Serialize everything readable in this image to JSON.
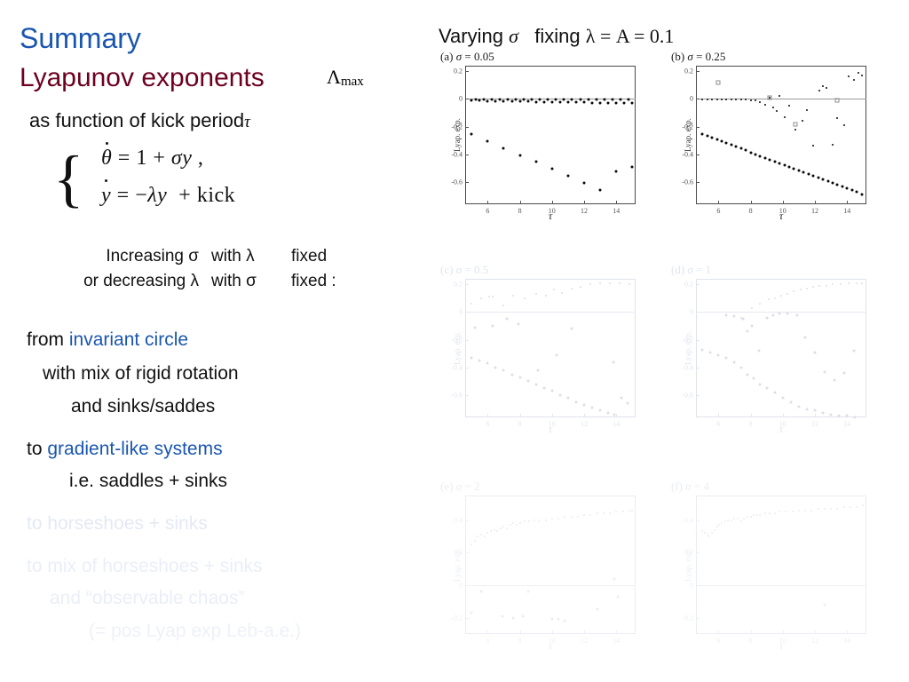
{
  "left": {
    "title_summary": "Summary",
    "title_lyapunov": "Lyapunov exponents",
    "lambda_max": "Λ",
    "lambda_max_sub": "max",
    "subtitle_prefix": "as function of kick period",
    "subtitle_tau": "τ",
    "equations": {
      "line1": "θ = 1 + σy ,",
      "line2": "y = −λy  + kick",
      "brace": "{"
    },
    "incdec": [
      {
        "c1": "Increasing σ",
        "c2": "with λ",
        "c3": "fixed"
      },
      {
        "c1": "or decreasing λ",
        "c2": "with σ",
        "c3": "fixed :"
      }
    ],
    "narrative": [
      {
        "plain": "from ",
        "accent": "invariant circle",
        "tone": "normal"
      },
      {
        "plain": "with mix of rigid rotation",
        "accent": "",
        "tone": "normal"
      },
      {
        "plain": "and  sinks/saddes",
        "accent": "",
        "tone": "normal"
      },
      {
        "plain": "to ",
        "accent": "gradient-like systems",
        "tone": "normal"
      },
      {
        "plain": "i.e. saddles + sinks",
        "accent": "",
        "tone": "normal"
      },
      {
        "plain": "to ",
        "accent": "horseshoes + sinks",
        "tone": "fade1"
      },
      {
        "plain": "to ",
        "accent": "mix of horseshoes + sinks",
        "tone": "fade2"
      },
      {
        "plain": "and  “observable chaos”",
        "accent": "",
        "tone": "fade2"
      },
      {
        "plain": "(= pos Lyap exp Leb-a.e.)",
        "accent": "",
        "tone": "fade3"
      }
    ],
    "colors": {
      "blue": "#1a56b0",
      "darkred": "#6d0020",
      "black": "#111111"
    }
  },
  "right": {
    "header": "Varying σ   fixing λ = A = 0.1",
    "header_parts": {
      "varying": "Varying",
      "sigma": "σ",
      "fixing": "fixing",
      "lambda_eq": "λ = A = 0.1"
    }
  },
  "chart_data": [
    {
      "id": "a",
      "type": "scatter",
      "title": "(a) σ = 0.05",
      "panel_letter": "(a)",
      "sigma": "0.05",
      "xlabel": "τ",
      "ylabel": "Lyap. exp.",
      "xlim": [
        4.6,
        15.2
      ],
      "ylim": [
        -0.76,
        0.24
      ],
      "xticks": [
        6,
        8,
        10,
        12,
        14
      ],
      "yticks": [
        0.2,
        0,
        -0.2,
        -0.4,
        -0.6
      ],
      "ytick_labels": [
        "0.2",
        "0",
        "-0.2",
        "-0.4",
        "-0.6"
      ],
      "grid": false,
      "opacity": 1,
      "series": [
        {
          "name": "upper-exponent",
          "x": [
            5,
            5.25,
            5.5,
            5.75,
            6,
            6.25,
            6.5,
            6.75,
            7,
            7.25,
            7.5,
            7.75,
            8,
            8.25,
            8.5,
            8.75,
            9,
            9.25,
            9.5,
            9.75,
            10,
            10.25,
            10.5,
            10.75,
            11,
            11.25,
            11.5,
            11.75,
            12,
            12.25,
            12.5,
            12.75,
            13,
            13.25,
            13.5,
            13.75,
            14,
            14.25,
            14.5,
            14.75,
            15
          ],
          "y": [
            -0.01,
            -0.005,
            -0.012,
            -0.004,
            -0.014,
            -0.005,
            -0.015,
            -0.004,
            -0.016,
            -0.005,
            -0.017,
            -0.004,
            -0.018,
            -0.005,
            -0.019,
            -0.004,
            -0.02,
            -0.005,
            -0.021,
            -0.004,
            -0.022,
            -0.005,
            -0.023,
            -0.004,
            -0.024,
            -0.005,
            -0.025,
            -0.004,
            -0.026,
            -0.005,
            -0.027,
            -0.004,
            -0.028,
            -0.005,
            -0.029,
            -0.004,
            -0.03,
            -0.005,
            -0.031,
            -0.004,
            -0.032
          ]
        },
        {
          "name": "lower-exponent",
          "x": [
            5,
            6,
            7,
            8,
            9,
            10,
            11,
            12,
            13,
            14,
            15
          ],
          "y": [
            -0.255,
            -0.305,
            -0.355,
            -0.405,
            -0.455,
            -0.505,
            -0.555,
            -0.605,
            -0.655,
            -0.525,
            -0.49
          ]
        }
      ]
    },
    {
      "id": "b",
      "type": "scatter",
      "title": "(b) σ = 0.25",
      "panel_letter": "(b)",
      "sigma": "0.25",
      "xlabel": "τ",
      "ylabel": "Lyap. exp.",
      "xlim": [
        4.6,
        15.2
      ],
      "ylim": [
        -0.76,
        0.24
      ],
      "xticks": [
        6,
        8,
        10,
        12,
        14
      ],
      "yticks": [
        0.2,
        0,
        -0.2,
        -0.4,
        -0.6
      ],
      "ytick_labels": [
        "0.2",
        "0",
        "-0.2",
        "-0.4",
        "-0.6"
      ],
      "grid": false,
      "opacity": 1,
      "series": [
        {
          "name": "upper-exponent",
          "x": [
            5,
            5.3,
            5.6,
            5.9,
            6.2,
            6.5,
            6.8,
            7.1,
            7.4,
            7.7,
            8,
            8.3,
            8.6,
            8.9,
            9.2,
            9.4,
            9.6,
            9.8,
            10.1,
            10.4,
            10.8,
            11.2,
            11.5,
            11.9,
            12.3,
            12.5,
            12.7,
            13.1,
            13.4,
            13.8,
            14.1,
            14.4,
            14.7,
            14.9
          ],
          "y": [
            -0.005,
            -0.006,
            -0.004,
            -0.005,
            -0.006,
            -0.004,
            -0.005,
            -0.006,
            -0.004,
            -0.005,
            -0.008,
            -0.012,
            -0.02,
            -0.04,
            0.01,
            -0.06,
            -0.09,
            0.02,
            -0.13,
            -0.05,
            -0.22,
            -0.16,
            -0.08,
            -0.34,
            0.06,
            0.09,
            0.08,
            -0.33,
            -0.14,
            -0.19,
            0.16,
            0.14,
            0.19,
            0.17
          ]
        },
        {
          "name": "lower-exponent",
          "x": [
            5,
            5.3,
            5.6,
            5.9,
            6.2,
            6.5,
            6.8,
            7.1,
            7.4,
            7.7,
            8,
            8.3,
            8.6,
            8.9,
            9.2,
            9.5,
            9.8,
            10.1,
            10.4,
            10.7,
            11,
            11.3,
            11.6,
            11.9,
            12.2,
            12.5,
            12.8,
            13.1,
            13.4,
            13.7,
            14,
            14.3,
            14.6,
            14.9
          ],
          "y": [
            -0.255,
            -0.268,
            -0.281,
            -0.294,
            -0.307,
            -0.32,
            -0.333,
            -0.346,
            -0.359,
            -0.372,
            -0.385,
            -0.398,
            -0.411,
            -0.424,
            -0.437,
            -0.45,
            -0.463,
            -0.476,
            -0.489,
            -0.502,
            -0.515,
            -0.528,
            -0.541,
            -0.554,
            -0.567,
            -0.58,
            -0.593,
            -0.606,
            -0.619,
            -0.632,
            -0.645,
            -0.658,
            -0.671,
            -0.69
          ]
        },
        {
          "name": "outlier-markers",
          "x": [
            6.0,
            9.2,
            10.8,
            13.4
          ],
          "y": [
            0.12,
            0.01,
            -0.18,
            -0.01
          ]
        }
      ]
    },
    {
      "id": "c",
      "type": "scatter",
      "title": "(c) σ = 0.5",
      "panel_letter": "(c)",
      "sigma": "0.5",
      "xlabel": "τ",
      "ylabel": "Lyap. exp.",
      "xlim": [
        4.6,
        15.2
      ],
      "ylim": [
        -0.76,
        0.24
      ],
      "xticks": [
        6,
        8,
        10,
        12,
        14
      ],
      "yticks": [
        0.2,
        0,
        -0.2,
        -0.4,
        -0.6
      ],
      "ytick_labels": [
        "0.2",
        "0",
        "-0.2",
        "-0.4",
        "-0.6"
      ],
      "grid": false,
      "opacity": 0.08,
      "series": [
        {
          "name": "upper-exponent",
          "x": [
            5,
            5.6,
            6.1,
            6.3,
            7,
            7.6,
            8.3,
            9,
            9.6,
            10.1,
            10.6,
            11.2,
            11.8,
            12.4,
            13,
            13.6,
            14.2,
            14.8
          ],
          "y": [
            0.06,
            0.1,
            0.11,
            0.11,
            0.05,
            0.12,
            0.1,
            0.13,
            0.12,
            0.16,
            0.14,
            0.17,
            0.18,
            0.2,
            0.21,
            0.21,
            0.21,
            0.2
          ]
        },
        {
          "name": "lower-exponent",
          "x": [
            5,
            5.5,
            6,
            6.5,
            7,
            7.5,
            8,
            8.5,
            9,
            9.5,
            10,
            10.5,
            11,
            11.5,
            12,
            12.5,
            13,
            13.5,
            13.9
          ],
          "y": [
            -0.33,
            -0.35,
            -0.37,
            -0.4,
            -0.42,
            -0.45,
            -0.47,
            -0.5,
            -0.52,
            -0.55,
            -0.57,
            -0.6,
            -0.62,
            -0.65,
            -0.67,
            -0.69,
            -0.71,
            -0.73,
            -0.74
          ]
        },
        {
          "name": "scatter-cloud",
          "x": [
            5.2,
            6.3,
            7.2,
            7.9,
            9.1,
            10.3,
            11.2,
            13.8,
            14.3,
            14.7
          ],
          "y": [
            -0.11,
            -0.1,
            -0.05,
            -0.09,
            -0.42,
            -0.31,
            -0.12,
            -0.36,
            -0.62,
            -0.66
          ]
        }
      ]
    },
    {
      "id": "d",
      "type": "scatter",
      "title": "(d) σ = 1",
      "panel_letter": "(d)",
      "sigma": "1",
      "xlabel": "τ",
      "ylabel": "Lyap. exp.",
      "xlim": [
        4.6,
        15.2
      ],
      "ylim": [
        -0.76,
        0.24
      ],
      "xticks": [
        6,
        8,
        10,
        12,
        14
      ],
      "yticks": [
        0.2,
        0,
        -0.2,
        -0.4,
        -0.6
      ],
      "ytick_labels": [
        "0.2",
        "0",
        "-0.2",
        "-0.4",
        "-0.6"
      ],
      "grid": false,
      "opacity": 0.07,
      "series": [
        {
          "name": "upper-exponent",
          "x": [
            7.4,
            8.1,
            8.6,
            9.1,
            9.5,
            9.9,
            10.3,
            10.7,
            11.1,
            11.5,
            11.9,
            12.3,
            12.7,
            13.1,
            13.6,
            14.1,
            14.6,
            14.9
          ],
          "y": [
            -0.04,
            0.03,
            0.06,
            0.09,
            0.1,
            0.12,
            0.13,
            0.15,
            0.16,
            0.17,
            0.18,
            0.19,
            0.19,
            0.2,
            0.2,
            0.21,
            0.21,
            0.21
          ]
        },
        {
          "name": "lower-exponent",
          "x": [
            5,
            5.5,
            6,
            6.5,
            7,
            7.4,
            7.8,
            8.2,
            8.6,
            9,
            9.5,
            10,
            10.5,
            11,
            11.5,
            12,
            12.5,
            13,
            13.5,
            14,
            14.5
          ],
          "y": [
            -0.27,
            -0.29,
            -0.31,
            -0.33,
            -0.36,
            -0.4,
            -0.45,
            -0.48,
            -0.52,
            -0.55,
            -0.58,
            -0.62,
            -0.65,
            -0.68,
            -0.7,
            -0.71,
            -0.73,
            -0.74,
            -0.75,
            -0.75,
            -0.76
          ]
        },
        {
          "name": "scatter-cloud",
          "x": [
            6.5,
            7.0,
            7.5,
            7.8,
            8.1,
            8.5,
            9.0,
            9.4,
            9.8,
            10.3,
            10.9,
            11.4,
            12.0,
            12.6,
            13.2,
            13.8,
            14.4
          ],
          "y": [
            -0.02,
            -0.03,
            -0.05,
            -0.14,
            -0.1,
            -0.28,
            -0.04,
            -0.02,
            -0.01,
            -0.01,
            -0.02,
            -0.18,
            -0.29,
            -0.43,
            -0.49,
            -0.44,
            -0.28
          ]
        }
      ]
    },
    {
      "id": "e",
      "type": "scatter",
      "title": "(e) σ = 2",
      "panel_letter": "(e)",
      "sigma": "2",
      "xlabel": "τ",
      "ylabel": "Lyap. exp.",
      "xlim": [
        4.6,
        15.2
      ],
      "ylim": [
        -0.3,
        0.55
      ],
      "xticks": [
        6,
        8,
        10,
        12,
        14
      ],
      "yticks": [
        0.4,
        0.2,
        0,
        -0.2
      ],
      "ytick_labels": [
        "0.4",
        "0.2",
        "0",
        "-0.2"
      ],
      "grid": false,
      "opacity": 0.1,
      "series": [
        {
          "name": "upper-exponent",
          "x": [
            5,
            5.2,
            5.4,
            5.6,
            5.8,
            6,
            6.2,
            6.4,
            6.6,
            6.8,
            7,
            7.2,
            7.4,
            7.6,
            7.8,
            8,
            8.3,
            8.6,
            8.9,
            9.2,
            9.6,
            10,
            10.4,
            10.8,
            11.2,
            11.6,
            12,
            12.4,
            12.8,
            13.2,
            13.6,
            14,
            14.4,
            14.8,
            15
          ],
          "y": [
            0.25,
            0.27,
            0.3,
            0.31,
            0.3,
            0.32,
            0.33,
            0.34,
            0.33,
            0.35,
            0.36,
            0.35,
            0.37,
            0.38,
            0.37,
            0.38,
            0.39,
            0.39,
            0.4,
            0.4,
            0.4,
            0.41,
            0.41,
            0.42,
            0.42,
            0.42,
            0.43,
            0.43,
            0.44,
            0.44,
            0.44,
            0.45,
            0.45,
            0.45,
            0.46
          ]
        },
        {
          "name": "lower-exponent",
          "x": [
            5,
            5.6,
            6.9,
            7.6,
            8.2,
            8.5,
            10,
            10.4,
            10.8,
            12.8,
            13.9,
            14.1
          ],
          "y": [
            -0.17,
            -0.04,
            -0.19,
            -0.2,
            -0.19,
            -0.04,
            -0.21,
            -0.21,
            -0.22,
            -0.15,
            0.04,
            -0.07
          ]
        }
      ]
    },
    {
      "id": "f",
      "type": "scatter",
      "title": "(f) σ = 4",
      "panel_letter": "(f)",
      "sigma": "4",
      "xlabel": "τ",
      "ylabel": "Lyap. exp.",
      "xlim": [
        4.6,
        15.2
      ],
      "ylim": [
        -0.3,
        0.55
      ],
      "xticks": [
        6,
        8,
        10,
        12,
        14
      ],
      "yticks": [
        0.4,
        0.2,
        0,
        -0.2
      ],
      "ytick_labels": [
        "0.4",
        "0.2",
        "0",
        "-0.2"
      ],
      "grid": false,
      "opacity": 0.07,
      "series": [
        {
          "name": "upper-exponent",
          "x": [
            5,
            5.15,
            5.3,
            5.45,
            5.6,
            5.75,
            5.9,
            6.05,
            6.2,
            6.4,
            6.6,
            6.8,
            7,
            7.2,
            7.4,
            7.6,
            7.8,
            8,
            8.2,
            8.4,
            8.6,
            8.9,
            9.2,
            9.5,
            9.8,
            10.2,
            10.6,
            11,
            11.4,
            11.8,
            12.2,
            12.6,
            13,
            13.4,
            13.8,
            14.2,
            14.6,
            15
          ],
          "y": [
            0.33,
            0.32,
            0.31,
            0.3,
            0.32,
            0.34,
            0.36,
            0.37,
            0.38,
            0.39,
            0.4,
            0.4,
            0.41,
            0.41,
            0.39,
            0.41,
            0.42,
            0.42,
            0.43,
            0.43,
            0.43,
            0.44,
            0.44,
            0.44,
            0.45,
            0.45,
            0.45,
            0.46,
            0.46,
            0.46,
            0.47,
            0.47,
            0.47,
            0.47,
            0.48,
            0.48,
            0.48,
            0.49
          ]
        },
        {
          "name": "lower-exponent",
          "x": [
            12.6
          ],
          "y": [
            -0.12
          ]
        }
      ]
    }
  ]
}
